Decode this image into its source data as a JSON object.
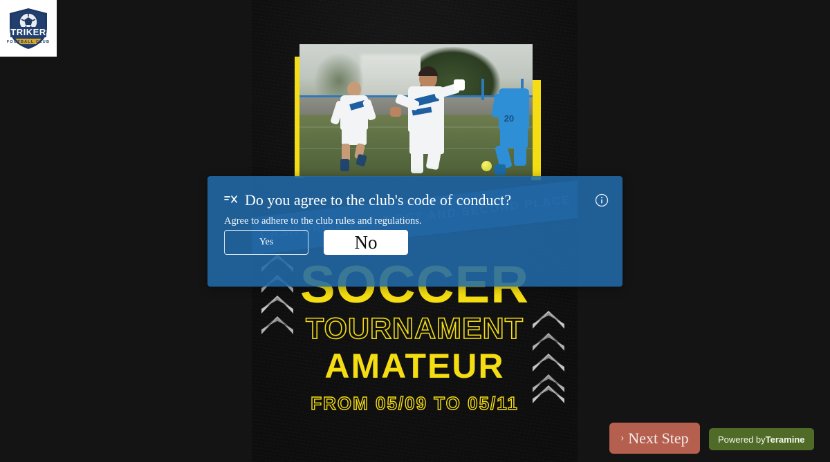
{
  "brand": {
    "logo_icon": "strikers-shield-logo",
    "logo_text": "STRIKERS",
    "logo_subtext": "FOOTBALL CLUB"
  },
  "poster": {
    "banner_text": "CASH PRIZE FOR FIRST AND SECOND PLACE",
    "title": "SOCCER",
    "subtitle": "TOURNAMENT",
    "level": "AMATEUR",
    "dates": "FROM 05/09 TO 05/11",
    "accent_color": "#f4dd12",
    "background_color": "#141414",
    "photo_alt": "soccer-player-photo"
  },
  "modal": {
    "icon": "shuffle-icon",
    "title": "Do you agree to the club's code of conduct?",
    "subtitle": "Agree to adhere to the club rules and regulations.",
    "info_icon": "info-circle-icon",
    "buttons": {
      "yes": "Yes",
      "no": "No"
    },
    "background_color": "#216aa8"
  },
  "footer": {
    "next_step_caret": "›",
    "next_step_label": "Next Step",
    "next_step_color": "#b5604e",
    "powered_prefix": "Powered by",
    "powered_brand": "Teramine",
    "powered_color": "#4f6b27"
  }
}
